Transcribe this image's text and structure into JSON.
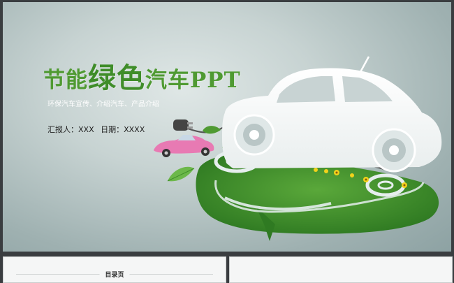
{
  "slide": {
    "title_part1": "节能",
    "title_part2": "绿色",
    "title_part3": "汽车PPT",
    "subtitle": "环保汽车宣传、介绍汽车、产品介绍",
    "reporter": "汇报人：XXX",
    "date": "日期：XXXX"
  },
  "thumbnails": {
    "next_title": "目录页"
  },
  "colors": {
    "title_green": "#4f9a32",
    "grass_green": "#3f8d29",
    "background": "#c7d3d2"
  }
}
